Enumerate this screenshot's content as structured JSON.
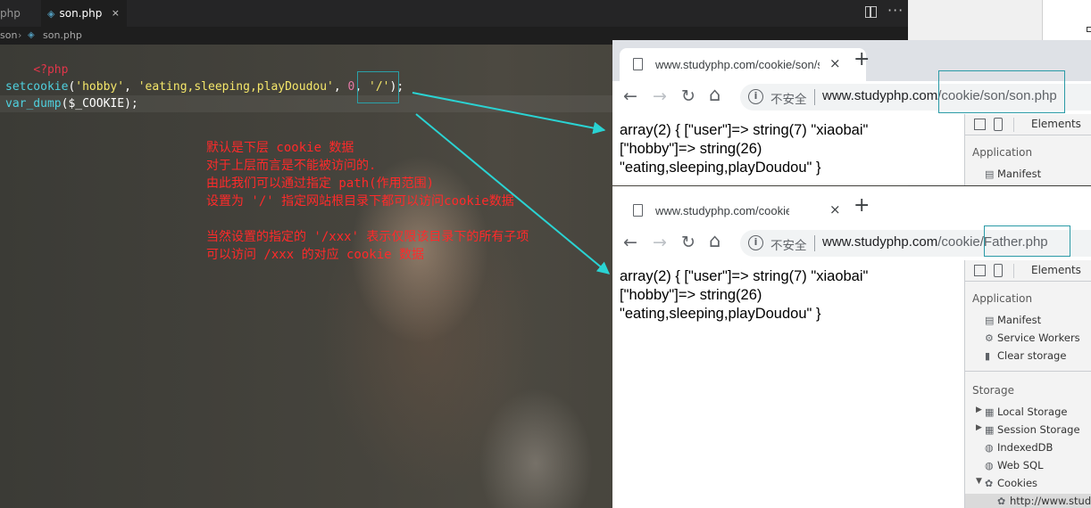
{
  "editor": {
    "tabs": [
      {
        "label": "php",
        "active": false
      },
      {
        "label": "son.php",
        "active": true
      }
    ],
    "tab_close": "×",
    "more_icon": "···",
    "breadcrumbs": [
      "son",
      "son.php"
    ],
    "code": {
      "l1_tag": "<?php",
      "l3_fn": "setcookie",
      "l3_open": "(",
      "l3_s1": "'hobby'",
      "l3_c1": ", ",
      "l3_s2": "'eating,sleeping,playDoudou'",
      "l3_c2": ", ",
      "l3_num": "0",
      "l3_c3": ", ",
      "l3_s3": "'/'",
      "l3_close": ");",
      "l4_fn": "var_dump",
      "l4_rest": "($_COOKIE);"
    },
    "notes": [
      "默认是下层 cookie 数据",
      "对于上层而言是不能被访问的.",
      "由此我们可以通过指定 path(作用范围)",
      "设置为 '/' 指定网站根目录下都可以访问cookie数据",
      "当然设置的指定的 '/xxx' 表示仅限该目录下的所有子项",
      "可以访问 /xxx 的对应 cookie 数据"
    ]
  },
  "browser_son": {
    "tab_title": "www.studyphp.com/cookie/son/son.php",
    "tab_close": "×",
    "new_tab": "+",
    "nav": {
      "back": "←",
      "forward": "→",
      "reload": "↻",
      "home": "⌂"
    },
    "info": "i",
    "insecure": "不安全",
    "url_host": "www.studyphp.com",
    "url_path": "/cookie/son/son.php",
    "output": [
      "array(2) { [\"user\"]=> string(7) \"xiaobai\"",
      "[\"hobby\"]=> string(26)",
      "\"eating,sleeping,playDoudou\" }"
    ],
    "devtools": {
      "tab": "Elements",
      "application": "Application",
      "items": [
        "Manifest"
      ]
    }
  },
  "browser_father": {
    "tab_title": "www.studyphp.com/cookie/Father.php",
    "tab_close": "×",
    "new_tab": "+",
    "nav": {
      "back": "←",
      "forward": "→",
      "reload": "↻",
      "home": "⌂"
    },
    "info": "i",
    "insecure": "不安全",
    "url_host": "www.studyphp.com",
    "url_path_a": "/cookie",
    "url_path_b": "/Father.php",
    "output": [
      "array(2) { [\"user\"]=> string(7) \"xiaobai\"",
      "[\"hobby\"]=> string(26)",
      "\"eating,sleeping,playDoudou\" }"
    ],
    "devtools": {
      "tab": "Elements",
      "application": "Application",
      "app_items": [
        {
          "icon": "▤",
          "label": "Manifest"
        },
        {
          "icon": "⚙",
          "label": "Service Workers"
        },
        {
          "icon": "▮",
          "label": "Clear storage"
        }
      ],
      "storage": "Storage",
      "storage_items": [
        {
          "icon": "▦",
          "label": "Local Storage",
          "expand": "▶"
        },
        {
          "icon": "▦",
          "label": "Session Storage",
          "expand": "▶"
        },
        {
          "icon": "◍",
          "label": "IndexedDB",
          "expand": ""
        },
        {
          "icon": "◍",
          "label": "Web SQL",
          "expand": ""
        },
        {
          "icon": "✿",
          "label": "Cookies",
          "expand": "▼"
        }
      ],
      "cookie_origin": "http://www.studyphp.com"
    }
  },
  "colors": {
    "arrow": "#2ad3d3",
    "note": "#ff2a2a",
    "highlight_box": "#2a9aa6"
  }
}
